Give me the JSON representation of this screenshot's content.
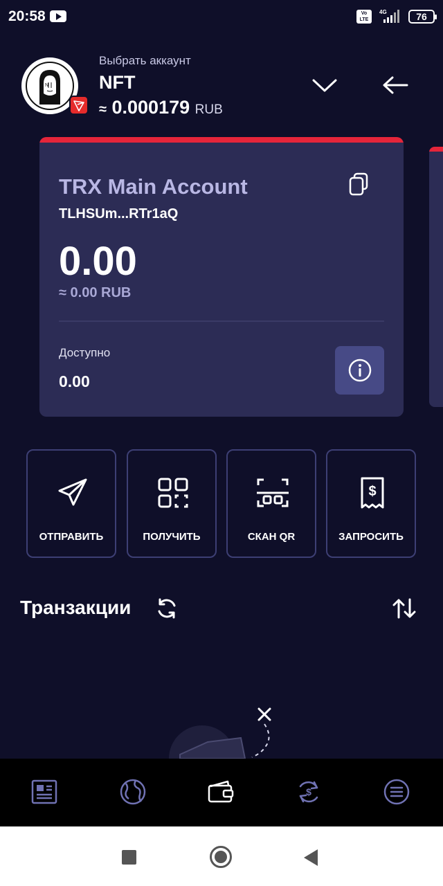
{
  "status_bar": {
    "time": "20:58",
    "network": "4G",
    "volte": "Vo LTE",
    "battery": "76"
  },
  "header": {
    "select_account_label": "Выбрать аккаунт",
    "account_name": "NFT",
    "approx_symbol": "≈",
    "balance": "0.000179",
    "currency": "RUB"
  },
  "card": {
    "title": "TRX Main Account",
    "address": "TLHSUm...RTr1aQ",
    "amount": "0.00",
    "fiat": "≈ 0.00 RUB",
    "available_label": "Доступно",
    "available_value": "0.00",
    "accent_color": "#e5253a"
  },
  "actions": [
    {
      "label": "ОТПРАВИТЬ",
      "icon": "send-icon"
    },
    {
      "label": "ПОЛУЧИТЬ",
      "icon": "qr-receive-icon"
    },
    {
      "label": "СКАН QR",
      "icon": "scan-qr-icon"
    },
    {
      "label": "ЗАПРОСИТЬ",
      "icon": "request-invoice-icon"
    }
  ],
  "transactions": {
    "title": "Транзакции"
  },
  "bottom_nav": [
    {
      "icon": "news-icon"
    },
    {
      "icon": "browser-globe-icon"
    },
    {
      "icon": "wallet-icon",
      "active": true
    },
    {
      "icon": "swap-icon"
    },
    {
      "icon": "menu-icon"
    }
  ]
}
